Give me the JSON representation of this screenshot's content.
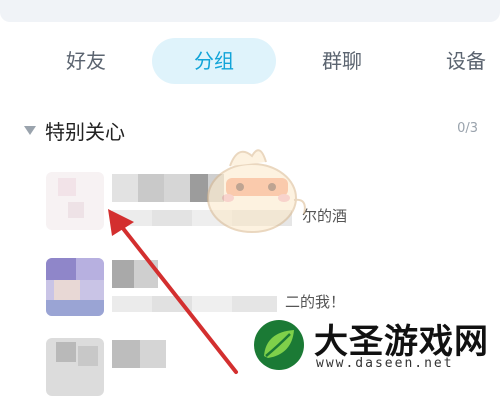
{
  "tabs": [
    {
      "label": "好友",
      "active": false
    },
    {
      "label": "分组",
      "active": true
    },
    {
      "label": "群聊",
      "active": false
    },
    {
      "label": "设备",
      "active": false
    }
  ],
  "group": {
    "title": "特别关心",
    "count": "0/3"
  },
  "contacts": [
    {
      "message_tail": "尔的酒"
    },
    {
      "message_tail": "二的我！"
    },
    {
      "message_tail": ""
    }
  ],
  "watermark": {
    "title": "大圣游戏网",
    "url": "www.daseen.net"
  },
  "colors": {
    "accent": "#12a4d8",
    "tab_active_bg": "#dff3fb",
    "arrow": "#d32f2f"
  },
  "icons": {
    "collapse": "triangle-down-icon",
    "mascot": "chick-mascot-icon",
    "logo": "leaf-logo-icon"
  }
}
